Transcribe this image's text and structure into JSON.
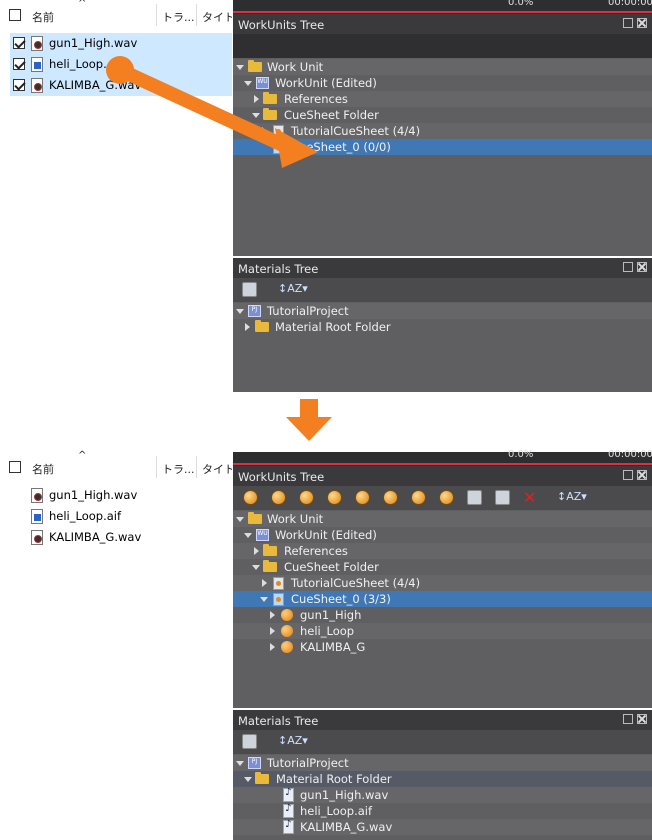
{
  "explorer": {
    "col_name": "名前",
    "col_track": "トラ...",
    "col_title": "タイトル",
    "before_files": [
      {
        "label": "gun1_High.wav",
        "type": "wav"
      },
      {
        "label": "heli_Loop.",
        "type": "aif"
      },
      {
        "label": "KALIMBA_G.wav",
        "type": "wav"
      }
    ],
    "after_files": [
      {
        "label": "gun1_High.wav",
        "type": "wav"
      },
      {
        "label": "heli_Loop.aif",
        "type": "aif"
      },
      {
        "label": "KALIMBA_G.wav",
        "type": "wav"
      }
    ]
  },
  "timeline": {
    "pct": "0.0%",
    "time": "00:00:00"
  },
  "before": {
    "workunits_title": "WorkUnits Tree",
    "workunits": [
      {
        "label": "Work Unit"
      },
      {
        "label": "WorkUnit (Edited)"
      },
      {
        "label": "References"
      },
      {
        "label": "CueSheet Folder"
      },
      {
        "label": "TutorialCueSheet (4/4)"
      },
      {
        "label": "CueSheet_0 (0/0)"
      }
    ],
    "materials_title": "Materials Tree",
    "materials": [
      {
        "label": "TutorialProject"
      },
      {
        "label": "Material Root Folder"
      }
    ]
  },
  "after": {
    "workunits_title": "WorkUnits Tree",
    "workunits": [
      {
        "label": "Work Unit"
      },
      {
        "label": "WorkUnit (Edited)"
      },
      {
        "label": "References"
      },
      {
        "label": "CueSheet Folder"
      },
      {
        "label": "TutorialCueSheet (4/4)"
      },
      {
        "label": "CueSheet_0 (3/3)"
      },
      {
        "label": "gun1_High"
      },
      {
        "label": "heli_Loop"
      },
      {
        "label": "KALIMBA_G"
      }
    ],
    "materials_title": "Materials Tree",
    "materials": [
      {
        "label": "TutorialProject"
      },
      {
        "label": "Material Root Folder"
      },
      {
        "label": "gun1_High.wav"
      },
      {
        "label": "heli_Loop.aif"
      },
      {
        "label": "KALIMBA_G.wav"
      }
    ]
  },
  "colors": {
    "arrow": "#f47f20",
    "selection": "#3f78b4",
    "explorer_selection": "#cde8ff",
    "timeline_red": "#e03040"
  }
}
